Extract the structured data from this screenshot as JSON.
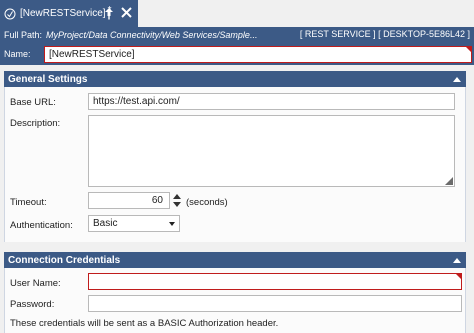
{
  "tab": {
    "title": "[NewRESTService]",
    "dirty_marker": "*"
  },
  "pathbar": {
    "label": "Full Path:",
    "path": "MyProject/Data Connectivity/Web Services/Sample...",
    "context": "[ REST SERVICE ] [ DESKTOP-5E86L42 ]"
  },
  "name_row": {
    "label": "Name:",
    "value": "[NewRESTService]"
  },
  "general": {
    "header": "General Settings",
    "base_url_label": "Base URL:",
    "base_url_value": "https://test.api.com/",
    "description_label": "Description:",
    "description_value": "",
    "timeout_label": "Timeout:",
    "timeout_value": "60",
    "timeout_unit": "(seconds)",
    "auth_label": "Authentication:",
    "auth_value": "Basic"
  },
  "credentials": {
    "header": "Connection Credentials",
    "user_label": "User Name:",
    "user_value": "",
    "password_label": "Password:",
    "password_value": "",
    "note": "These credentials will be sent as a BASIC Authorization header."
  },
  "colors": {
    "header_blue": "#3c5a86",
    "error_red": "#c01c1c",
    "panel_bg": "#fbfbfb"
  }
}
